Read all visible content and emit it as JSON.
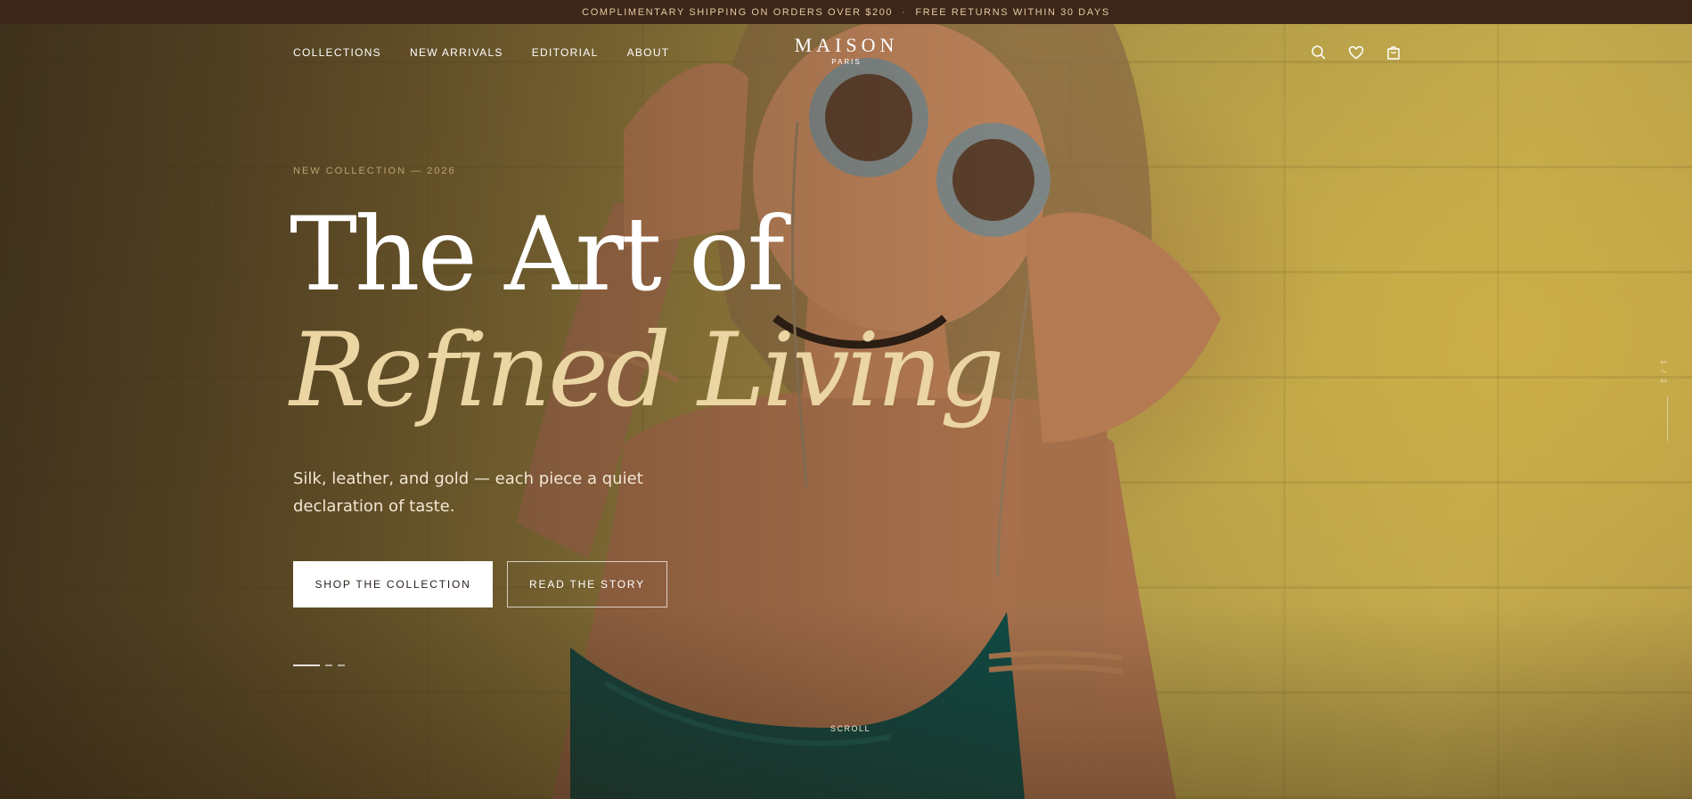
{
  "announcement": {
    "left": "COMPLIMENTARY SHIPPING ON ORDERS OVER $200",
    "separator": "·",
    "right": "FREE RETURNS WITHIN 30 DAYS"
  },
  "nav": {
    "links": [
      "COLLECTIONS",
      "NEW ARRIVALS",
      "EDITORIAL",
      "ABOUT"
    ],
    "logo": "MAISON",
    "logo_sub": "PARIS",
    "icons": [
      "search-icon",
      "heart-icon",
      "shopping-bag-icon"
    ]
  },
  "hero": {
    "eyebrow": "NEW COLLECTION — 2026",
    "headline_line1": "The Art of",
    "headline_line2": "Refined Living",
    "subcopy": "Silk, leather, and gold — each piece a quiet declaration of taste.",
    "primary_cta": "SHOP THE COLLECTION",
    "secondary_cta": "READ THE STORY",
    "scroll_label": "SCROLL",
    "counter": "1 / 3"
  },
  "colors": {
    "announcement_bg": "#3b2619",
    "announcement_text": "#e4c9a0",
    "headline_accent": "#ead5a3",
    "wall": "#b09a48"
  }
}
